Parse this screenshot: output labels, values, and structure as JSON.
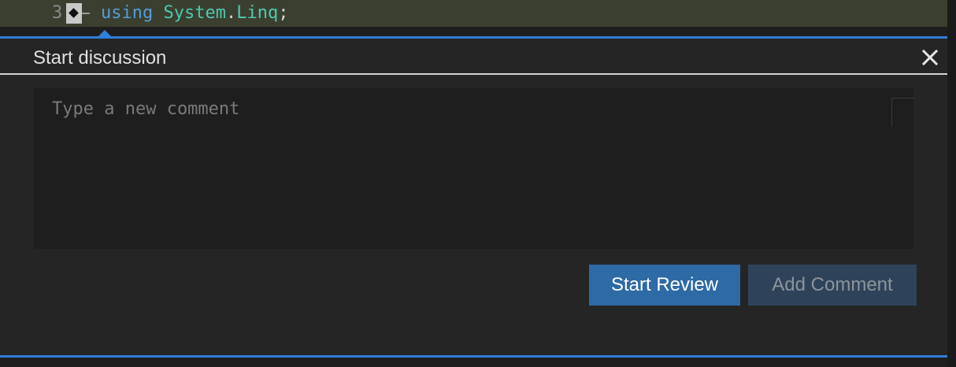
{
  "editor": {
    "line_number": "3",
    "code": {
      "keyword": "using",
      "namespace_root": "System",
      "dot": ".",
      "namespace_leaf": "Linq",
      "semicolon": ";"
    },
    "gutter_icon": "comment-range-glyph-icon"
  },
  "discussion": {
    "title": "Start discussion",
    "close_icon": "close-icon",
    "comment_placeholder": "Type a new comment",
    "comment_value": "",
    "start_review_label": "Start Review",
    "add_comment_label": "Add Comment",
    "add_comment_enabled": false
  },
  "colors": {
    "accent": "#2f7ed8",
    "primary_button": "#2d6aa6",
    "disabled_button": "#2e4359",
    "code_line_highlight": "#3b3f2f",
    "keyword": "#569cd6",
    "type": "#4ec9b0"
  }
}
